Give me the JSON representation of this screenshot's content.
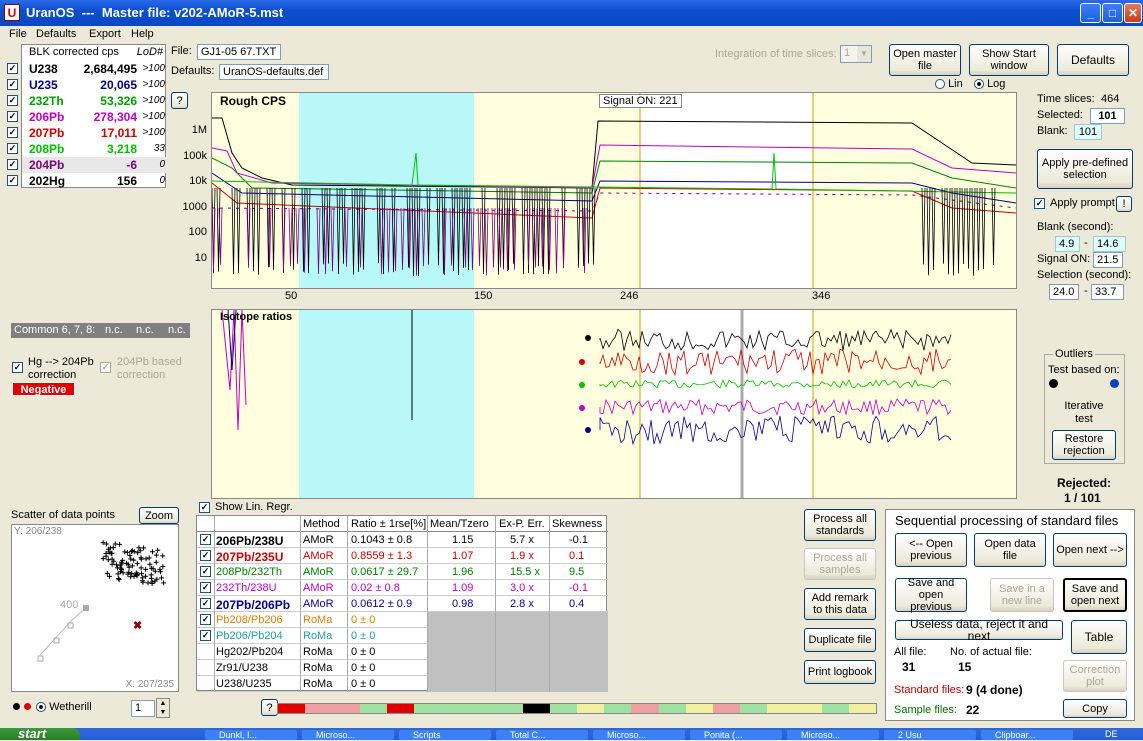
{
  "window": {
    "app": "UranOS",
    "sep": "---",
    "title": "Master file:  v202-AMoR-5.mst",
    "icon": "uranos-app-icon"
  },
  "menu": [
    "File",
    "Defaults",
    "Export",
    "Help"
  ],
  "elements": {
    "header": "BLK corrected cps",
    "lod_header": "LoD#",
    "rows": [
      {
        "name": "U238",
        "value": "2,684,495",
        "lod": ">100",
        "color": "#000000"
      },
      {
        "name": "U235",
        "value": "20,065",
        "lod": ">100",
        "color": "#00008b"
      },
      {
        "name": "232Th",
        "value": "53,326",
        "lod": ">100",
        "color": "#00a000"
      },
      {
        "name": "206Pb",
        "value": "278,304",
        "lod": ">100",
        "color": "#c000c0"
      },
      {
        "name": "207Pb",
        "value": "17,011",
        "lod": ">100",
        "color": "#d00000"
      },
      {
        "name": "208Pb",
        "value": "3,218",
        "lod": "33",
        "color": "#00c000"
      },
      {
        "name": "204Pb",
        "value": "-6",
        "lod": "0",
        "color": "#800080"
      },
      {
        "name": "202Hg",
        "value": "156",
        "lod": "0",
        "color": "#000000"
      }
    ]
  },
  "file": {
    "label": "File:",
    "value": "GJ1-05 67.TXT",
    "defaults_label": "Defaults:",
    "defaults_value": "UranOS-defaults.def"
  },
  "integration": {
    "label": "Integration of time slices:",
    "value": "1"
  },
  "buttons": {
    "open_master": "Open master file",
    "start_window": "Show Start window",
    "defaults": "Defaults",
    "help_q": "?",
    "apply_predefined": "Apply pre-defined selection",
    "apply_prompt": "Apply prompt",
    "excl": "!",
    "restore": "Restore rejection",
    "zoom": "Zoom",
    "process_std": "Process all standards",
    "process_samples": "Process all samples",
    "add_remark": "Add remark to this data",
    "duplicate": "Duplicate file",
    "print_logbook": "Print logbook",
    "open_prev": "<-- Open previous",
    "open_data": "Open data file",
    "open_next": "Open next -->",
    "save_open_prev": "Save and open previous",
    "save_new_line": "Save in a new line",
    "save_open_next": "Save and open next",
    "useless": "Useless data, reject it and next",
    "table": "Table",
    "correction_plot": "Correction plot",
    "copy": "Copy",
    "help_q2": "?"
  },
  "scale": {
    "lin": "Lin",
    "log": "Log"
  },
  "timeinfo": {
    "slices_label": "Time slices:",
    "slices": "464",
    "selected_label": "Selected:",
    "selected": "101",
    "blank_label": "Blank:",
    "blank": "101",
    "blank_sec_label": "Blank (second):",
    "blank_from": "4.9",
    "dash": "-",
    "blank_to": "14.6",
    "signal_on_label": "Signal ON:",
    "signal_on": "21.5",
    "selection_label": "Selection (second):",
    "sel_from": "24.0",
    "sel_to": "33.7"
  },
  "chart_top": {
    "title": "Rough CPS",
    "signal_label": "Signal ON:  221",
    "ylabels": [
      "1M",
      "100k",
      "10k",
      "1000",
      "100",
      "10"
    ],
    "xlabels": [
      "50",
      "150",
      "246",
      "346"
    ]
  },
  "chart_bottom": {
    "title": "Isotope ratios"
  },
  "common": {
    "label": "Common 6, 7, 8:",
    "v1": "n.c.",
    "v2": "n.c.",
    "v3": "n.c."
  },
  "hg": {
    "label": "Hg --> 204Pb correction",
    "pb_based": "204Pb based correction",
    "negative": "Negative"
  },
  "outliers": {
    "title": "Outliers",
    "test": "Test based on:",
    "iterative": "Iterative test",
    "rejected_label": "Rejected:",
    "rejected": "1 / 101"
  },
  "scatter": {
    "title": "Scatter of data points",
    "ylabel": "Y: 206/238",
    "xlabel": "X: 207/235",
    "tick": "400",
    "wetherill": "Wetherill",
    "spin": "1"
  },
  "linreg": "Show Lin. Regr.",
  "ratio_table": {
    "headers": [
      "Method",
      "Ratio ± 1rse[%]",
      "Mean/Tzero",
      "Ex-P. Err.",
      "Skewness"
    ],
    "rows": [
      {
        "name": "206Pb/238U",
        "method": "AMoR",
        "ratio": "0.1043  ± 0.8",
        "mean": "1.15",
        "exp": "5.7 x",
        "skew": "-0.1",
        "color": "#000000",
        "bold": true,
        "checked": true
      },
      {
        "name": "207Pb/235U",
        "method": "AMoR",
        "ratio": "0.8559  ± 1.3",
        "mean": "1.07",
        "exp": "1.9 x",
        "skew": "0.1",
        "color": "#d00000",
        "bold": true,
        "checked": true
      },
      {
        "name": "208Pb/232Th",
        "method": "AMoR",
        "ratio": "0.0617  ± 29.7",
        "mean": "1.96",
        "exp": "15.5 x",
        "skew": "9.5",
        "color": "#008000",
        "bold": false,
        "checked": true
      },
      {
        "name": "232Th/238U",
        "method": "AMoR",
        "ratio": "0.02  ± 0.8",
        "mean": "1.09",
        "exp": "3.0 x",
        "skew": "-0.1",
        "color": "#c000c0",
        "bold": false,
        "checked": true
      },
      {
        "name": "207Pb/206Pb",
        "method": "AMoR",
        "ratio": "0.0612  ± 0.9",
        "mean": "0.98",
        "exp": "2.8 x",
        "skew": "0.4",
        "color": "#00008b",
        "bold": true,
        "checked": true
      },
      {
        "name": "Pb208/Pb206",
        "method": "RoMa",
        "ratio": "0  ± 0",
        "color": "#e08000",
        "checked": true
      },
      {
        "name": "Pb206/Pb204",
        "method": "RoMa",
        "ratio": "0  ± 0",
        "color": "#20a0a0",
        "checked": true
      },
      {
        "name": "Hg202/Pb204",
        "method": "RoMa",
        "ratio": "0  ± 0",
        "color": "#000000"
      },
      {
        "name": "Zr91/U238",
        "method": "RoMa",
        "ratio": "0  ± 0",
        "color": "#000000"
      },
      {
        "name": "U238/U235",
        "method": "RoMa",
        "ratio": "0  ± 0",
        "color": "#000000"
      }
    ]
  },
  "sequential": {
    "title": "Sequential processing of standard files",
    "all_file_label": "All file:",
    "all_file": "31",
    "actual_label": "No. of actual file:",
    "actual": "15",
    "std_label": "Standard files:",
    "std": "9 (4 done)",
    "sample_label": "Sample files:",
    "sample": "22"
  },
  "taskbar": {
    "start": "start",
    "items": [
      "Dunkl, I...",
      "Microso...",
      "Scripts",
      "Total C...",
      "Microso...",
      "Ponita (...",
      "Microso...",
      "2 Usu",
      "Clipboar..."
    ],
    "lang": "DE"
  }
}
